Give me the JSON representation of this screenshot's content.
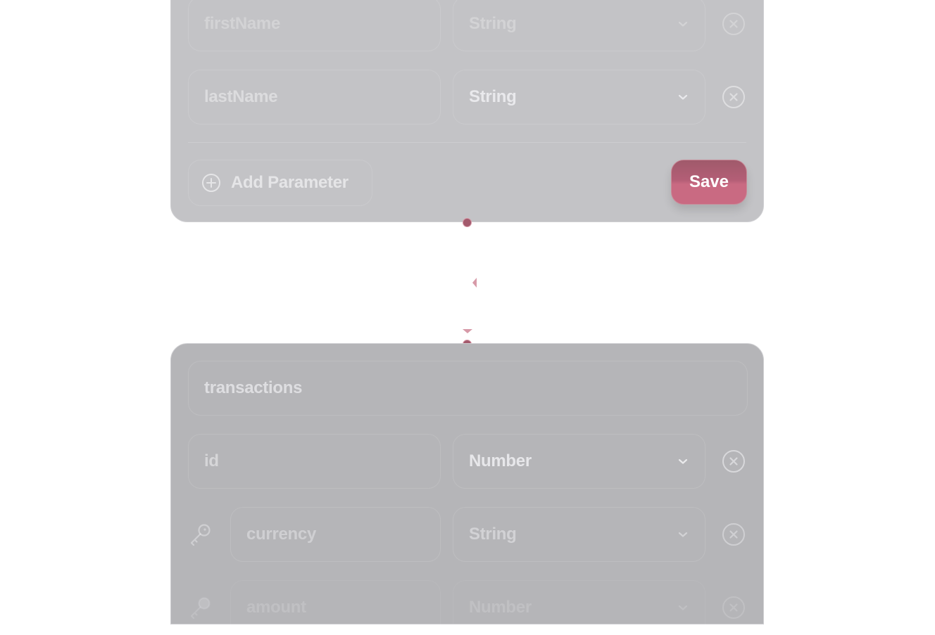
{
  "colors": {
    "accent": "#c96a82",
    "accent_dark": "#a05a6b",
    "handle": "#a35a6c",
    "top_node_bg": "#c3c3c6",
    "bottom_node_bg": "#b5b5b8"
  },
  "top_node": {
    "parameters": [
      {
        "name": "firstName",
        "type": "String"
      },
      {
        "name": "lastName",
        "type": "String"
      }
    ],
    "add_parameter_label": "Add Parameter",
    "save_label": "Save"
  },
  "bottom_node": {
    "title": "transactions",
    "parameters": [
      {
        "name": "id",
        "type": "Number",
        "key": false
      },
      {
        "name": "currency",
        "type": "String",
        "key": true
      },
      {
        "name": "amount",
        "type": "Number",
        "key": true
      }
    ]
  },
  "icons": {
    "remove": "circle-x-icon",
    "dropdown": "chevron-down-icon",
    "add": "plus-circle-icon",
    "key": "key-icon"
  }
}
